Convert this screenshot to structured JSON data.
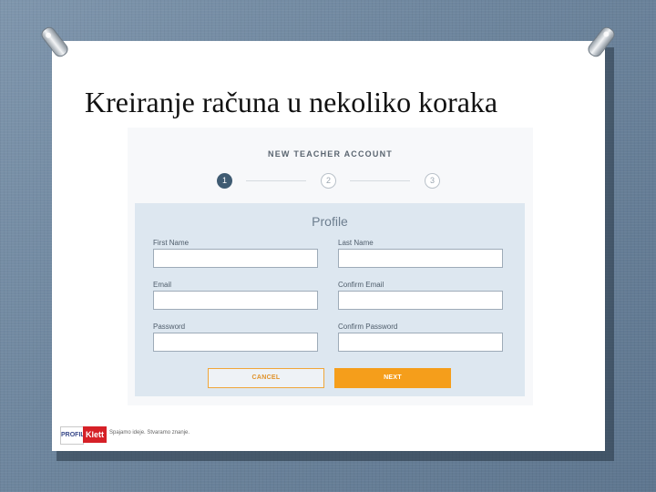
{
  "slide": {
    "title": "Kreiranje računa u nekoliko koraka"
  },
  "form": {
    "header": "NEW TEACHER ACCOUNT",
    "steps": [
      "1",
      "2",
      "3"
    ],
    "active_step": 1,
    "section_title": "Profile",
    "fields": {
      "first_name": {
        "label": "First Name",
        "value": ""
      },
      "last_name": {
        "label": "Last Name",
        "value": ""
      },
      "email": {
        "label": "Email",
        "value": ""
      },
      "confirm_email": {
        "label": "Confirm Email",
        "value": ""
      },
      "password": {
        "label": "Password",
        "value": ""
      },
      "confirm_password": {
        "label": "Confirm Password",
        "value": ""
      }
    },
    "cancel_label": "CANCEL",
    "next_label": "NEXT"
  },
  "logo": {
    "profil": "PROFIL",
    "klett": "Klett",
    "tagline": "Spajamo ideje. Stvaramo znanje."
  },
  "colors": {
    "accent_orange": "#f59e1b",
    "step_active": "#3f5b72",
    "card_bg": "#dde7f0",
    "klett_red": "#d62027"
  }
}
